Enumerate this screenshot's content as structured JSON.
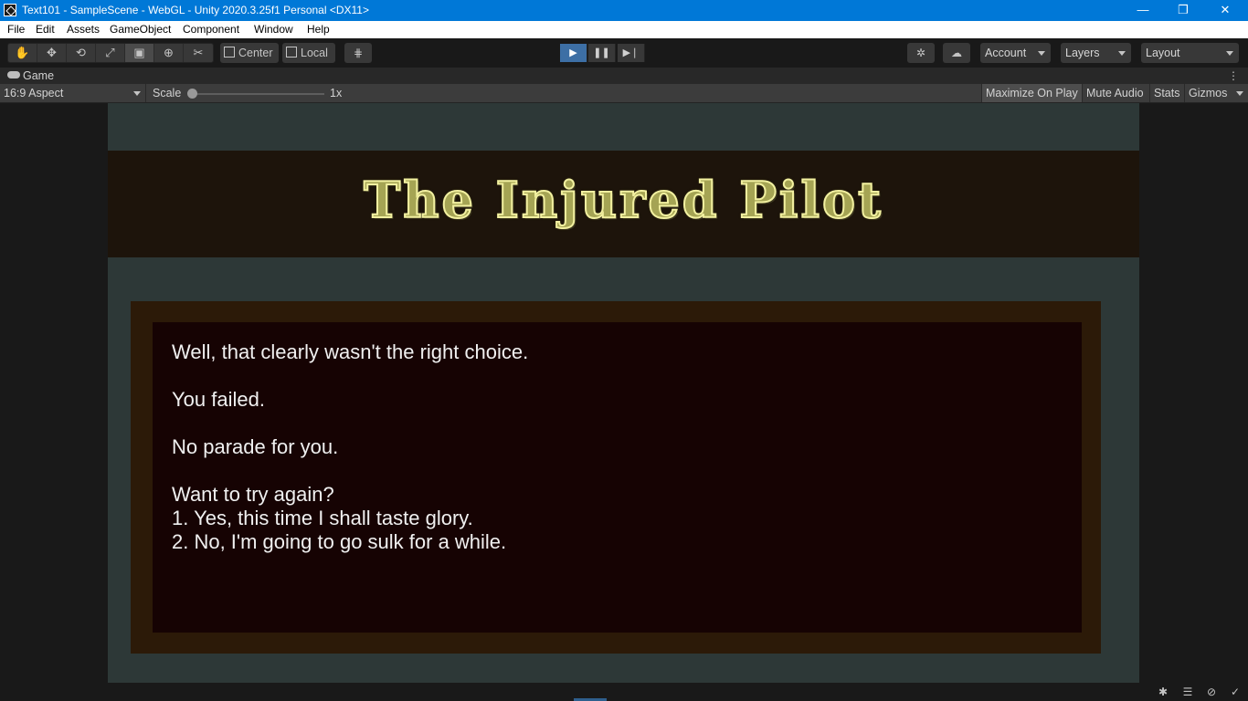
{
  "window": {
    "title": "Text101 - SampleScene - WebGL - Unity 2020.3.25f1 Personal <DX11>",
    "minimize": "—",
    "maximize": "❐",
    "close": "✕"
  },
  "menu": [
    "File",
    "Edit",
    "Assets",
    "GameObject",
    "Component",
    "Window",
    "Help"
  ],
  "toolbar": {
    "tools": [
      "hand-tool",
      "move-tool",
      "rotate-tool",
      "scale-tool",
      "rect-tool",
      "transform-tool",
      "custom-tool"
    ],
    "active_tool": "rect-tool",
    "pivot_mode": "Center",
    "pivot_rotation": "Local",
    "account": "Account",
    "layers": "Layers",
    "layout": "Layout"
  },
  "game_tab": {
    "label": "Game",
    "aspect": "16:9 Aspect",
    "scale_label": "Scale",
    "scale_value": "1x",
    "maximize_on_play": "Maximize On Play",
    "mute_audio": "Mute Audio",
    "stats": "Stats",
    "gizmos": "Gizmos"
  },
  "game": {
    "title": "The Injured Pilot",
    "story": "Well, that clearly wasn't the right choice.\n\nYou failed.\n\nNo parade for you.\n\nWant to try again?\n1. Yes, this time I shall taste glory.\n2. No, I'm going to go sulk for a while."
  },
  "colors": {
    "titlebar": "#0078d7",
    "play_active": "#3d6fa5",
    "game_bg": "#2d3837",
    "title_band": "#1d140b",
    "story_frame": "#2c1a08",
    "story_panel": "#160303",
    "title_text": "#a5a454"
  }
}
